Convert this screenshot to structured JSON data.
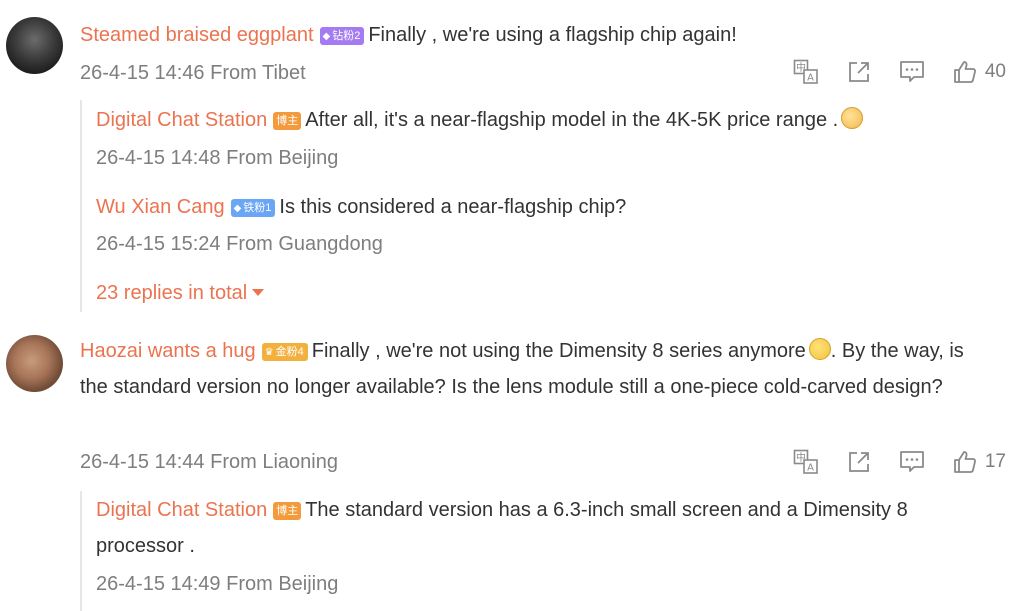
{
  "comments": [
    {
      "author": "Steamed braised eggplant",
      "badge": "钻粉2",
      "text": "Finally , we're using a flagship chip again!",
      "time": "26-4-15 14:46",
      "location": "From Tibet",
      "likes": "40",
      "replies": [
        {
          "author": "Digital Chat Station",
          "badge": "博主",
          "text": "After all, it's a near-flagship model in the 4K-5K price range .",
          "time": "26-4-15 14:48",
          "location": "From Beijing"
        },
        {
          "author": "Wu Xian Cang",
          "badge": "铁粉1",
          "text": "Is this considered a near-flagship chip?",
          "time": "26-4-15 15:24",
          "location": "From Guangdong"
        }
      ],
      "more_replies": "23 replies in total"
    },
    {
      "author": "Haozai wants a hug",
      "badge": "金粉4",
      "text_part1": "Finally , we're not using the Dimensity 8 series anymore",
      "text_part2": ". By the way, is the standard version no longer available? Is the lens module still a one-piece cold-carved design?",
      "time": "26-4-15 14:44",
      "location": "From Liaoning",
      "likes": "17",
      "replies": [
        {
          "author": "Digital Chat Station",
          "badge": "博主",
          "text": "The standard version has a 6.3-inch small screen and a Dimensity 8 processor .",
          "time": "26-4-15 14:49",
          "location": "From Beijing"
        }
      ]
    }
  ],
  "icons": {
    "translate": "translate-icon",
    "share": "share-icon",
    "comment": "comment-icon",
    "like": "thumbs-up-icon"
  },
  "colors": {
    "name": "#eb7350",
    "meta": "#7e7e7e",
    "badge_purple": "#a47bf0",
    "badge_blue": "#6aa6f5",
    "badge_gold": "#f2b13f",
    "badge_orange": "#f39b3c"
  }
}
